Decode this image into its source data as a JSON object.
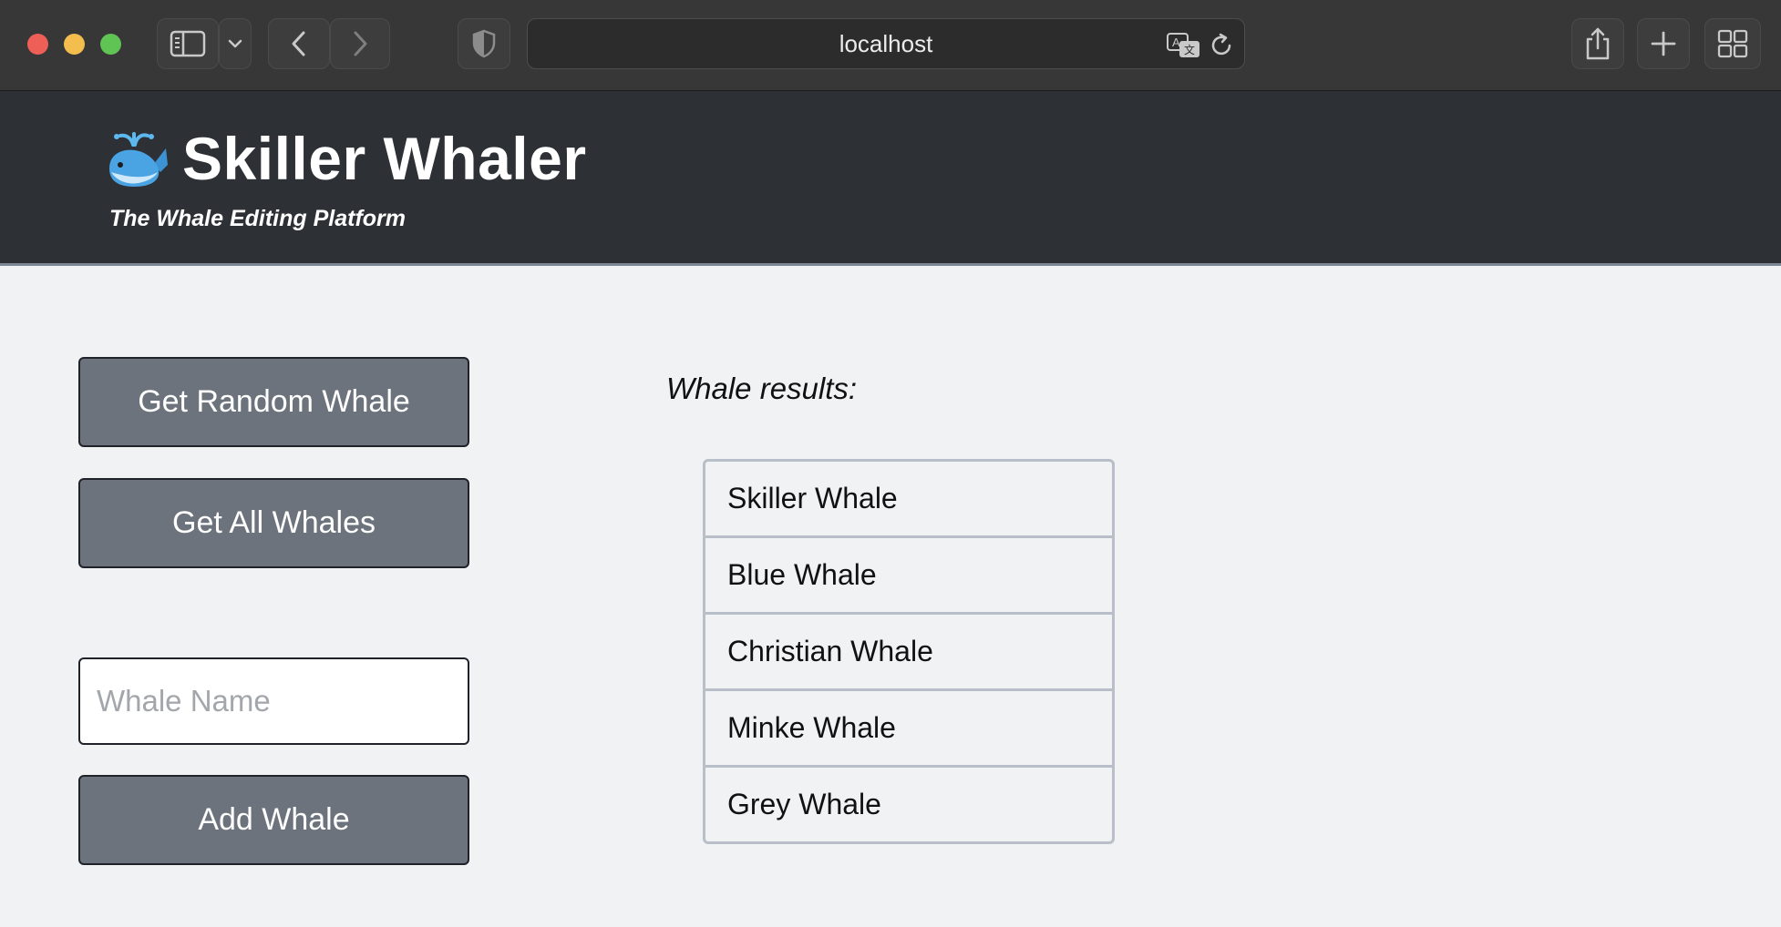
{
  "browser": {
    "url": "localhost",
    "icons": {
      "sidebar": "sidebar-icon",
      "dropdown": "chevron-down-icon",
      "back": "chevron-left-icon",
      "forward": "chevron-right-icon",
      "privacy": "shield-icon",
      "translate": "translate-icon",
      "reload": "reload-icon",
      "share": "share-icon",
      "new_tab": "plus-icon",
      "tab_overview": "grid-icon"
    }
  },
  "header": {
    "logo": "whale-emoji-icon",
    "title": "Skiller Whaler",
    "subtitle": "The Whale Editing Platform"
  },
  "controls": {
    "random_label": "Get Random Whale",
    "all_label": "Get All Whales",
    "name_placeholder": "Whale Name",
    "name_value": "",
    "add_label": "Add Whale"
  },
  "results": {
    "label": "Whale results:",
    "items": [
      "Skiller Whale",
      "Blue Whale",
      "Christian Whale",
      "Minke Whale",
      "Grey Whale"
    ]
  },
  "colors": {
    "header_bg": "#2d3035",
    "button_bg": "#6c737c",
    "page_bg": "#f1f2f4",
    "list_border": "#b8bfc8"
  }
}
